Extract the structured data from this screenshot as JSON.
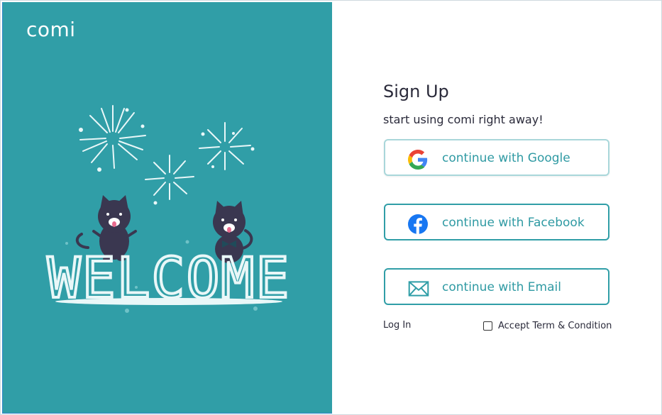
{
  "brand": {
    "logo": "comi"
  },
  "illustration": {
    "banner_text": "WELCOME"
  },
  "signup": {
    "title": "Sign Up",
    "subtitle": "start using comi right away!",
    "google_label": "continue with Google",
    "facebook_label": "continue with Facebook",
    "email_label": "continue with Email",
    "login_link": "Log In",
    "accept_label": "Accept Term & Condition"
  },
  "colors": {
    "teal": "#309ea7",
    "accent_text": "#2f9aa3",
    "dark_text": "#2a2a3a",
    "facebook_blue": "#1877f2"
  },
  "icons": {
    "google": "google-icon",
    "facebook": "facebook-icon",
    "email": "envelope-icon"
  }
}
